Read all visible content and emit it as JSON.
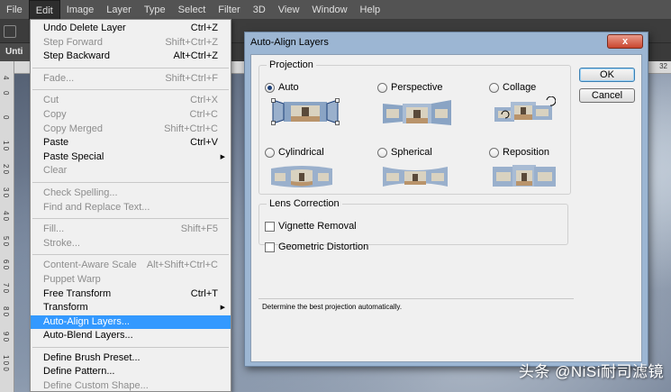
{
  "menubar": [
    "File",
    "Edit",
    "Image",
    "Layer",
    "Type",
    "Select",
    "Filter",
    "3D",
    "View",
    "Window",
    "Help"
  ],
  "doc_tab": "Unti",
  "ruler": {
    "top_value": "32",
    "left_values": [
      "4",
      "0",
      "0",
      "1 0",
      "2 0",
      "3 0",
      "4 0",
      "5 0",
      "6 0",
      "7 0",
      "8 0",
      "9 0",
      "1 0 0"
    ]
  },
  "edit_menu": {
    "items": [
      {
        "label": "Undo Delete Layer",
        "shortcut": "Ctrl+Z"
      },
      {
        "label": "Step Forward",
        "shortcut": "Shift+Ctrl+Z"
      },
      {
        "label": "Step Backward",
        "shortcut": "Alt+Ctrl+Z"
      },
      {
        "label": "Fade...",
        "shortcut": "Shift+Ctrl+F"
      },
      {
        "label": "Cut",
        "shortcut": "Ctrl+X"
      },
      {
        "label": "Copy",
        "shortcut": "Ctrl+C"
      },
      {
        "label": "Copy Merged",
        "shortcut": "Shift+Ctrl+C"
      },
      {
        "label": "Paste",
        "shortcut": "Ctrl+V"
      },
      {
        "label": "Paste Special",
        "shortcut": ""
      },
      {
        "label": "Clear",
        "shortcut": ""
      },
      {
        "label": "Check Spelling...",
        "shortcut": ""
      },
      {
        "label": "Find and Replace Text...",
        "shortcut": ""
      },
      {
        "label": "Fill...",
        "shortcut": "Shift+F5"
      },
      {
        "label": "Stroke...",
        "shortcut": ""
      },
      {
        "label": "Content-Aware Scale",
        "shortcut": "Alt+Shift+Ctrl+C"
      },
      {
        "label": "Puppet Warp",
        "shortcut": ""
      },
      {
        "label": "Free Transform",
        "shortcut": "Ctrl+T"
      },
      {
        "label": "Transform",
        "shortcut": ""
      },
      {
        "label": "Auto-Align Layers...",
        "shortcut": ""
      },
      {
        "label": "Auto-Blend Layers...",
        "shortcut": ""
      },
      {
        "label": "Define Brush Preset...",
        "shortcut": ""
      },
      {
        "label": "Define Pattern...",
        "shortcut": ""
      },
      {
        "label": "Define Custom Shape...",
        "shortcut": ""
      }
    ]
  },
  "dialog": {
    "title": "Auto-Align Layers",
    "close_label": "x",
    "projection_legend": "Projection",
    "projections": [
      "Auto",
      "Perspective",
      "Collage",
      "Cylindrical",
      "Spherical",
      "Reposition"
    ],
    "selected_projection": "Auto",
    "lens_legend": "Lens Correction",
    "vignette_label": "Vignette Removal",
    "geometric_label": "Geometric Distortion",
    "description": "Determine the best projection automatically.",
    "ok_label": "OK",
    "cancel_label": "Cancel"
  },
  "watermark": "头条 @NiSi耐司滤镜",
  "colors": {
    "menu_highlight": "#3399ff",
    "dialog_frame": "#9cb6d3",
    "close_button": "#c9462f"
  }
}
